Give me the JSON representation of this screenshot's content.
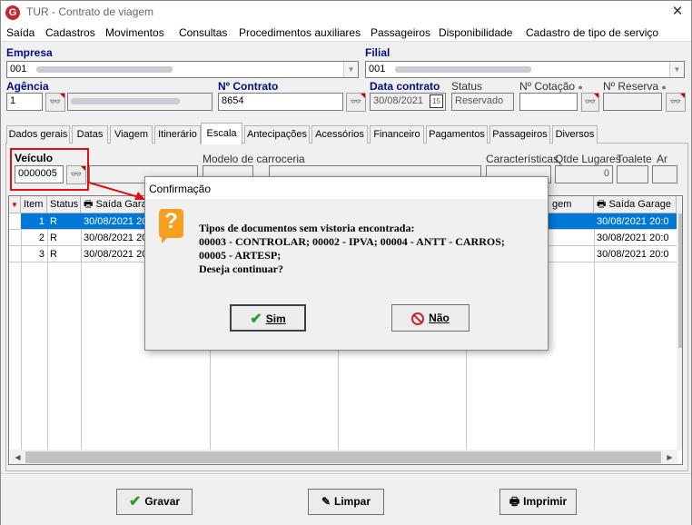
{
  "window": {
    "title": "TUR - Contrato de viagem",
    "app_icon": "G"
  },
  "menu": [
    "Saída",
    "Cadastros",
    "Movimentos",
    "Consultas",
    "Procedimentos auxiliares",
    "Passageiros",
    "Disponibilidade",
    "Cadastro de tipo de serviço"
  ],
  "header": {
    "empresa_label": "Empresa",
    "empresa_value": "001",
    "filial_label": "Filial",
    "filial_value": "001",
    "agencia_label": "Agência",
    "agencia_value": "1",
    "contrato_label": "Nº Contrato",
    "contrato_value": "8654",
    "data_label": "Data contrato",
    "data_value": "30/08/2021",
    "data_btn": "15",
    "status_label": "Status",
    "status_value": "Reservado",
    "cotacao_label": "Nº Cotação",
    "reserva_label": "Nº Reserva"
  },
  "tabs": [
    "Dados gerais",
    "Datas",
    "Viagem",
    "Itinerário",
    "Escala",
    "Antecipações",
    "Acessórios",
    "Financeiro",
    "Pagamentos",
    "Passageiros",
    "Diversos"
  ],
  "active_tab": "Escala",
  "escala": {
    "veiculo_label": "Veículo",
    "veiculo_value": "0000005",
    "modelo_label": "Modelo de carroceria",
    "caracteristicas_label": "Características",
    "qtde_label": "Qtde Lugares",
    "qtde_value": "0",
    "toalete_label": "Toalete",
    "ar_label": "Ar"
  },
  "grid": {
    "headers": {
      "item": "Item",
      "status": "Status",
      "saida": "Saída Gara",
      "viagem": "gem",
      "saida2": "Saída Garage"
    },
    "rows": [
      {
        "item": "1",
        "status": "R",
        "saida": "30/08/2021 20",
        "saida2": "30/08/2021 20:0"
      },
      {
        "item": "2",
        "status": "R",
        "saida": "30/08/2021 20",
        "saida2": "30/08/2021 20:0"
      },
      {
        "item": "3",
        "status": "R",
        "saida": "30/08/2021 20",
        "saida2": "30/08/2021 20:0"
      }
    ]
  },
  "dialog": {
    "title": "Confirmação",
    "message": "Tipos de documentos sem vistoria encontrada:\n00003 - CONTROLAR; 00002 - IPVA; 00004 - ANTT - CARROS;\n00005 - ARTESP;\nDeseja continuar?",
    "yes_label": "Sim",
    "no_label": "Não"
  },
  "buttons": {
    "gravar": "Gravar",
    "limpar": "Limpar",
    "imprimir": "Imprimir"
  },
  "colors": {
    "highlight": "#e01010",
    "selected_row": "#0078d7",
    "label_blue": "#000d80",
    "warning": "#f5a020"
  }
}
